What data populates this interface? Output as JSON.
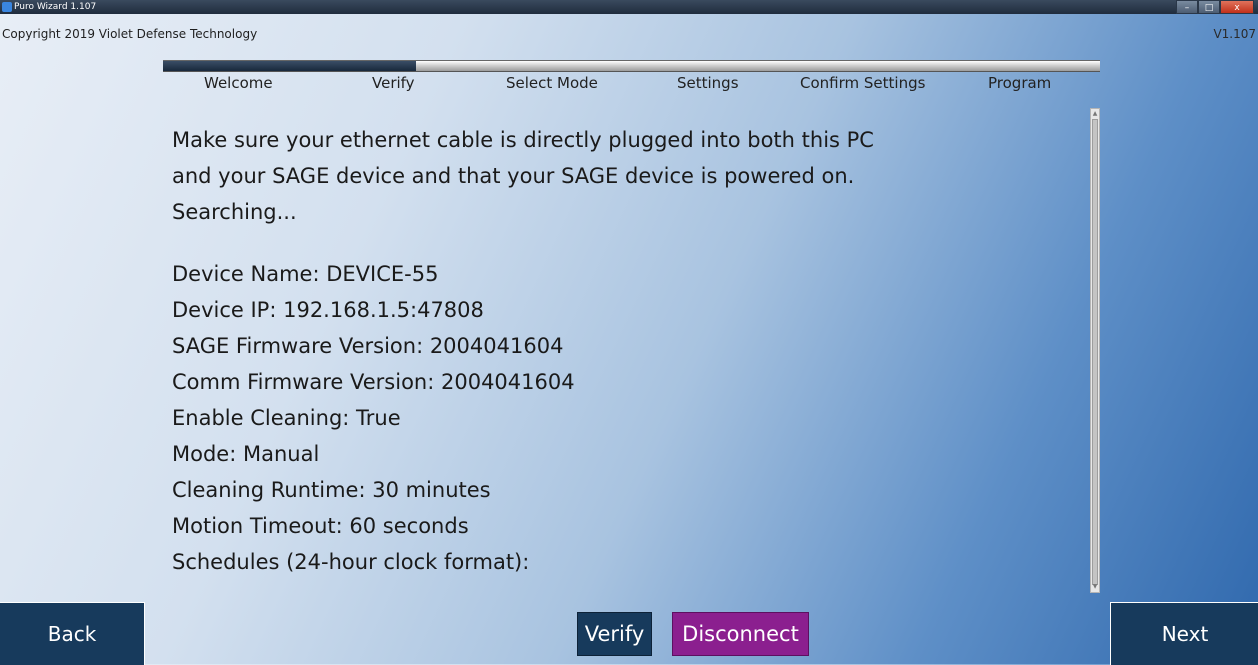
{
  "window": {
    "title": "Puro Wizard 1.107",
    "min_glyph": "–",
    "max_glyph": "□",
    "close_glyph": "x"
  },
  "header": {
    "copyright": "Copyright 2019 Violet Defense Technology",
    "version": "V1.107"
  },
  "wizard": {
    "progress_fraction": 0.27,
    "steps": [
      {
        "label": "Welcome"
      },
      {
        "label": "Verify"
      },
      {
        "label": "Select Mode"
      },
      {
        "label": "Settings"
      },
      {
        "label": "Confirm Settings"
      },
      {
        "label": "Program"
      }
    ]
  },
  "content": {
    "intro_line1": "Make sure your ethernet cable is directly plugged into both this PC",
    "intro_line2": "and your SAGE device and that your SAGE device is powered on.",
    "status": "Searching...",
    "details": [
      "Device Name: DEVICE-55",
      "Device IP: 192.168.1.5:47808",
      "SAGE Firmware Version: 2004041604",
      "Comm Firmware Version: 2004041604",
      "Enable Cleaning: True",
      "Mode: Manual",
      "Cleaning Runtime: 30 minutes",
      "Motion Timeout: 60 seconds",
      "Schedules (24-hour clock format):"
    ]
  },
  "buttons": {
    "back": "Back",
    "verify": "Verify",
    "disconnect": "Disconnect",
    "next": "Next"
  },
  "colors": {
    "nav_button": "#173a5c",
    "disconnect_button": "#8b1f8f",
    "progress_fill": "#18283c"
  }
}
